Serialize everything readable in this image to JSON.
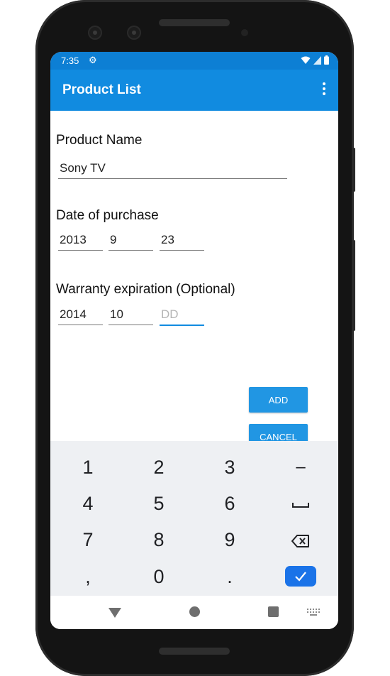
{
  "status_bar": {
    "time": "7:35"
  },
  "app_bar": {
    "title": "Product List"
  },
  "form": {
    "product_name_label": "Product Name",
    "product_name_value": "Sony TV",
    "purchase_label": "Date of purchase",
    "purchase_year": "2013",
    "purchase_month": "9",
    "purchase_day": "23",
    "warranty_label": "Warranty expiration (Optional)",
    "warranty_year": "2014",
    "warranty_month": "10",
    "warranty_day_placeholder": "DD"
  },
  "buttons": {
    "add": "ADD",
    "cancel": "CANCEL"
  },
  "keyboard": {
    "rows": [
      [
        "1",
        "2",
        "3",
        "–"
      ],
      [
        "4",
        "5",
        "6",
        "space"
      ],
      [
        "7",
        "8",
        "9",
        "backspace"
      ],
      [
        ",",
        "0",
        ".",
        "enter"
      ]
    ],
    "k1": "1",
    "k2": "2",
    "k3": "3",
    "minus": "–",
    "k4": "4",
    "k5": "5",
    "k6": "6",
    "k7": "7",
    "k8": "8",
    "k9": "9",
    "comma": ",",
    "k0": "0",
    "period": "."
  },
  "colors": {
    "status_bar": "#0d7fd4",
    "app_bar": "#118be0",
    "button": "#2196e3",
    "focus_underline": "#118be0",
    "enter_key": "#1a73e8"
  },
  "icons": {
    "status": [
      "gear-icon",
      "wifi-icon",
      "signal-icon",
      "battery-icon"
    ],
    "app_bar": [
      "overflow-menu-icon"
    ],
    "keyboard": [
      "space-icon",
      "backspace-icon",
      "check-icon"
    ],
    "nav": [
      "back-icon",
      "home-icon",
      "recents-icon",
      "keyboard-switch-icon"
    ]
  }
}
